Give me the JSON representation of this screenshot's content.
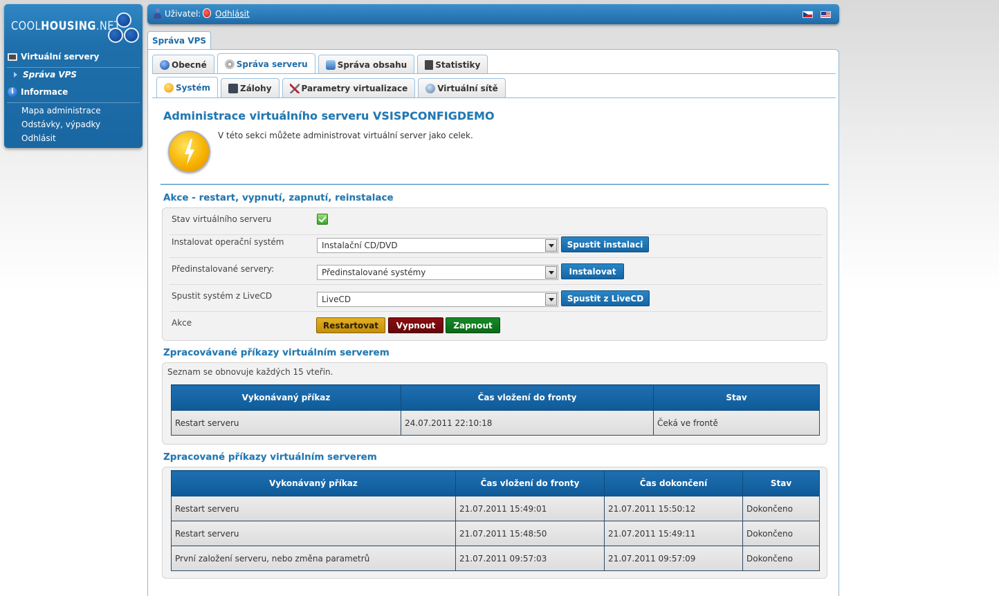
{
  "brand": {
    "logo_light": "COOL",
    "logo_bold": "HOUSING",
    "logo_tail": ".NET"
  },
  "sidebar": {
    "virtual_servers": "Virtuální servery",
    "manage_vps": "Správa VPS",
    "info": "Informace",
    "links": [
      "Mapa administrace",
      "Odstávky, výpadky",
      "Odhlásit"
    ]
  },
  "topbar": {
    "user_label": "Uživatel:",
    "logout": "Odhlásit"
  },
  "main_tab": "Správa VPS",
  "tabs": [
    "Obecné",
    "Správa serveru",
    "Správa obsahu",
    "Statistiky"
  ],
  "subtabs": [
    "Systém",
    "Zálohy",
    "Parametry virtualizace",
    "Virtuální sítě"
  ],
  "page": {
    "title": "Administrace virtuálního serveru VSISPCONFIGDEMO",
    "intro": "V této sekci můžete administrovat virtuální server jako celek."
  },
  "actions": {
    "heading": "Akce - restart, vypnutí, zapnutí, reinstalace",
    "rows": {
      "status": "Stav virtuálního serveru",
      "install_os": "Instalovat operační systém",
      "preinstalled": "Předinstalované servery:",
      "livecd": "Spustit systém z LiveCD",
      "actions": "Akce"
    },
    "install_select": "Instalační CD/DVD",
    "install_button": "Spustit instalaci",
    "preinstalled_select": "Předinstalované systémy",
    "preinstalled_button": "Instalovat",
    "livecd_select": "LiveCD",
    "livecd_button": "Spustit z LiveCD",
    "restart": "Restartovat",
    "shutdown": "Vypnout",
    "start": "Zapnout"
  },
  "pending": {
    "heading": "Zpracovávané příkazy virtuálním serverem",
    "note": "Seznam se obnovuje každých 15 vteřin.",
    "columns": [
      "Vykonávaný příkaz",
      "Čas vložení do fronty",
      "Stav"
    ],
    "rows": [
      [
        "Restart serveru",
        "24.07.2011 22:10:18",
        "Čeká ve frontě"
      ]
    ]
  },
  "done": {
    "heading": "Zpracované příkazy virtuálním serverem",
    "columns": [
      "Vykonávaný příkaz",
      "Čas vložení do fronty",
      "Čas dokončení",
      "Stav"
    ],
    "rows": [
      [
        "Restart serveru",
        "21.07.2011 15:49:01",
        "21.07.2011 15:50:12",
        "Dokončeno"
      ],
      [
        "Restart serveru",
        "21.07.2011 15:48:50",
        "21.07.2011 15:49:11",
        "Dokončeno"
      ],
      [
        "První založení serveru, nebo změna parametrů",
        "21.07.2011 09:57:03",
        "21.07.2011 09:57:09",
        "Dokončeno"
      ]
    ]
  }
}
